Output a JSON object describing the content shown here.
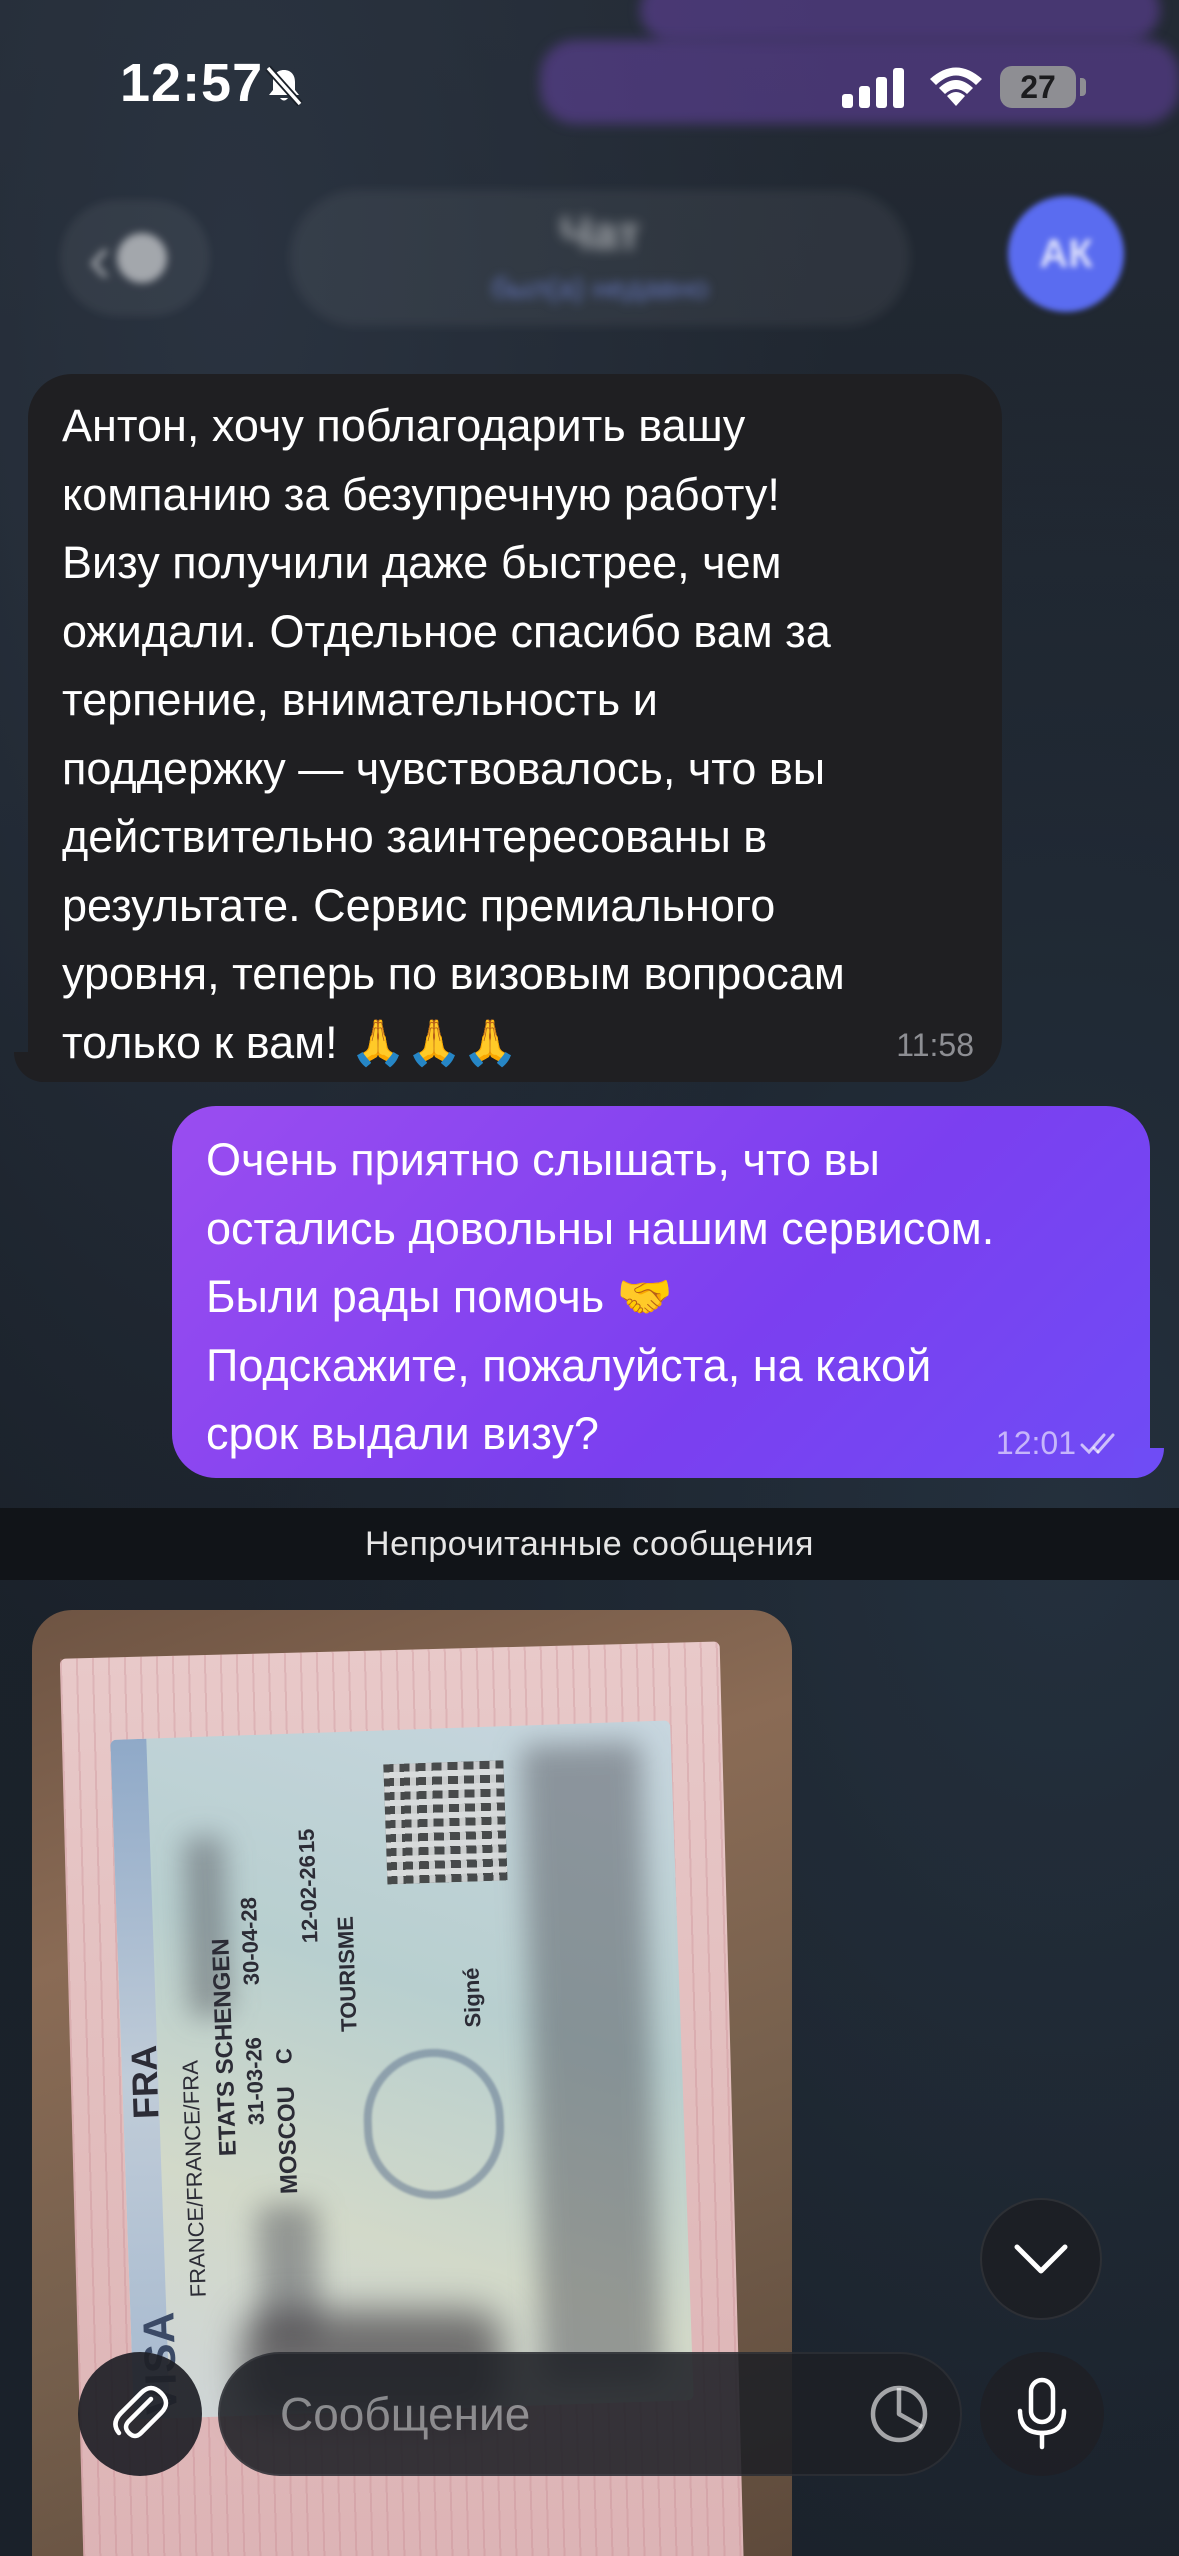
{
  "status_bar": {
    "time": "12:57",
    "battery": "27"
  },
  "header": {
    "back_label": "‹",
    "title": "Чат",
    "subtitle": "был(а) недавно",
    "avatar_initials": "АК"
  },
  "messages": [
    {
      "direction": "incoming",
      "text": "Антон, хочу поблагодарить вашу\nкомпанию за безупречную работу!\nВизу получили даже быстрее, чем\nожидали. Отдельное спасибо вам за\nтерпение, внимательность и\nподдержку — чувствовалось, что вы\nдействительно заинтересованы в\nрезультате. Сервис премиального\nуровня, теперь по визовым вопросам\nтолько к вам! 🙏🙏🙏",
      "time": "11:58"
    },
    {
      "direction": "outgoing",
      "text": "Очень приятно слышать, что вы\nостались довольны нашим сервисом.\nБыли рады помочь 🤝\nПодскажите, пожалуйста, на какой\nсрок выдали визу?",
      "time": "12:01",
      "status": "read"
    }
  ],
  "unread_divider": "Непрочитанные сообщения",
  "photo": {
    "visa_texts": [
      "VISA",
      "FRA",
      "FRANCE/FRANCE/FRA",
      "ETATS SCHENGEN",
      "MOSCOU",
      "TOURISME",
      "31-03-26",
      "30-04-28",
      "12-02-26",
      "C",
      "15",
      "Signé"
    ]
  },
  "composer": {
    "placeholder": "Сообщение"
  },
  "icons": {
    "bell_off": "bell-slash-icon",
    "signal": "cellular-signal-icon",
    "wifi": "wifi-icon",
    "attach": "paperclip-icon",
    "sticker": "sticker-icon",
    "mic": "microphone-icon",
    "scroll_down": "chevron-down-icon",
    "read_receipt": "double-check-icon"
  },
  "colors": {
    "accent": "#7b3ff0",
    "incoming_bubble": "#1f1f22",
    "background": "#1a2028"
  }
}
